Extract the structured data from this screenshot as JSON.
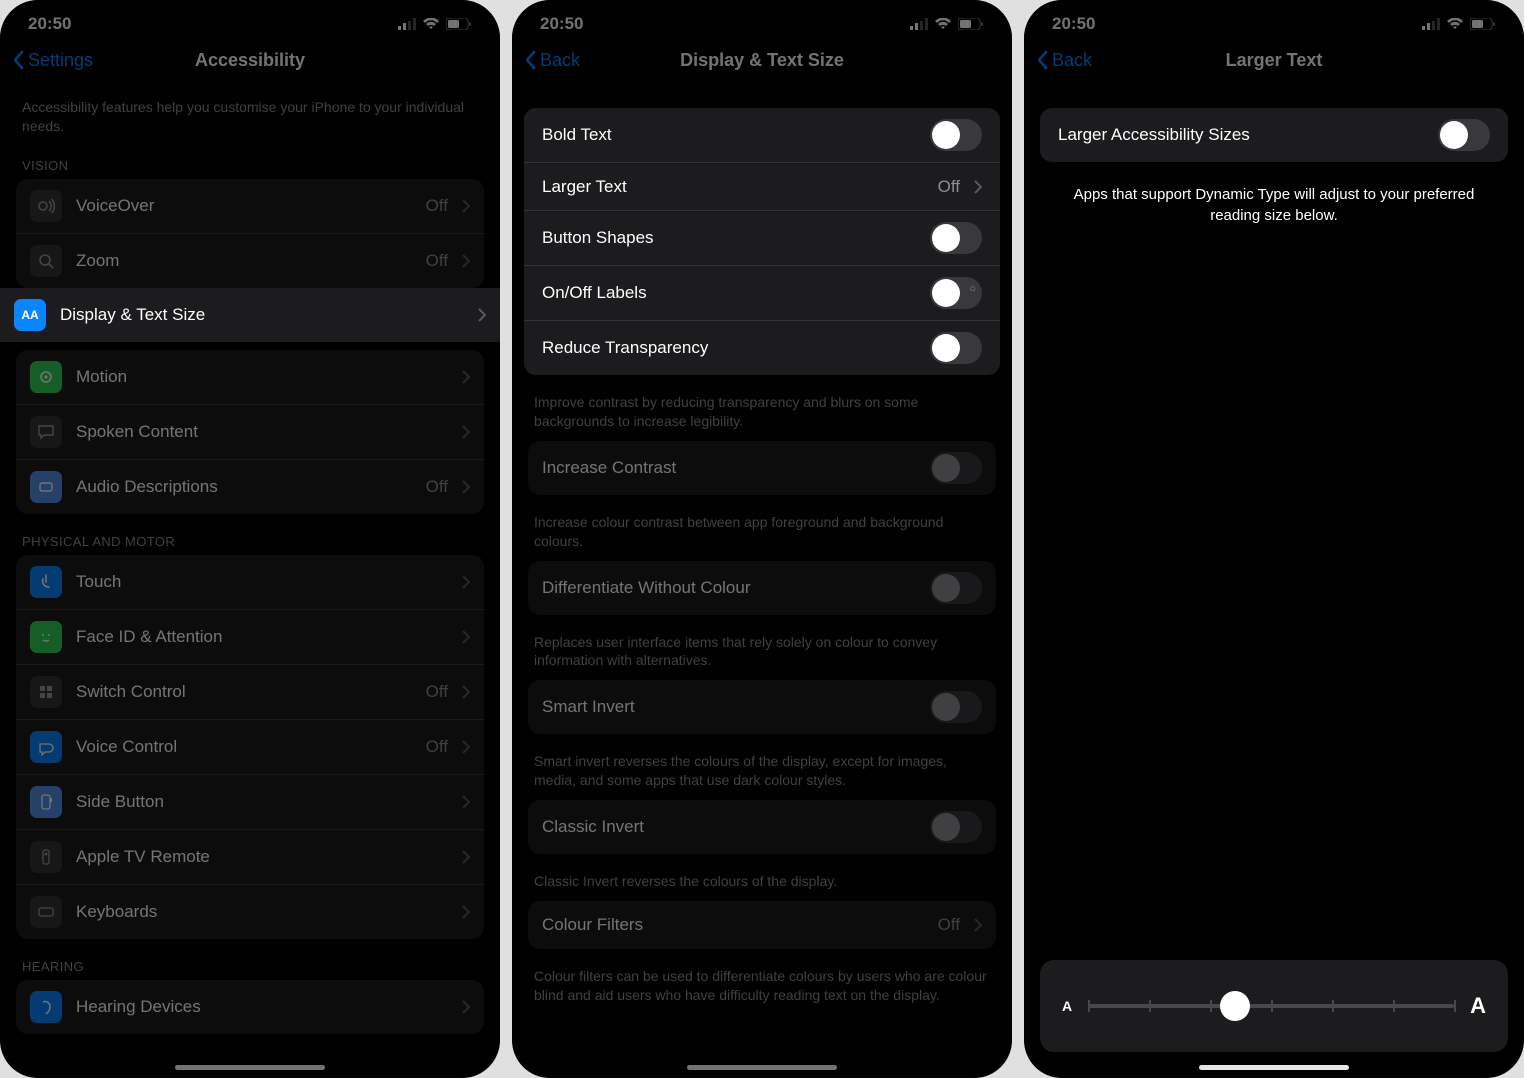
{
  "status": {
    "time": "20:50"
  },
  "phone1": {
    "back": "Settings",
    "title": "Accessibility",
    "intro": "Accessibility features help you customise your iPhone to your individual needs.",
    "sections": {
      "vision_hdr": "VISION",
      "phys_hdr": "PHYSICAL AND MOTOR",
      "hearing_hdr": "HEARING"
    },
    "items": {
      "voiceover": {
        "label": "VoiceOver",
        "value": "Off"
      },
      "zoom": {
        "label": "Zoom",
        "value": "Off"
      },
      "display": {
        "label": "Display & Text Size"
      },
      "motion": {
        "label": "Motion"
      },
      "spoken": {
        "label": "Spoken Content"
      },
      "audiodesc": {
        "label": "Audio Descriptions",
        "value": "Off"
      },
      "touch": {
        "label": "Touch"
      },
      "faceid": {
        "label": "Face ID & Attention"
      },
      "switch": {
        "label": "Switch Control",
        "value": "Off"
      },
      "voicectrl": {
        "label": "Voice Control",
        "value": "Off"
      },
      "sidebtn": {
        "label": "Side Button"
      },
      "appletv": {
        "label": "Apple TV Remote"
      },
      "keyboards": {
        "label": "Keyboards"
      },
      "hearingdev": {
        "label": "Hearing Devices"
      }
    }
  },
  "phone2": {
    "back": "Back",
    "title": "Display & Text Size",
    "items": {
      "bold": {
        "label": "Bold Text"
      },
      "larger": {
        "label": "Larger Text",
        "value": "Off"
      },
      "buttonshapes": {
        "label": "Button Shapes"
      },
      "onoff": {
        "label": "On/Off Labels"
      },
      "reducetrans": {
        "label": "Reduce Transparency"
      },
      "reducetrans_desc": "Improve contrast by reducing transparency and blurs on some backgrounds to increase legibility.",
      "incrcontrast": {
        "label": "Increase Contrast"
      },
      "incrcontrast_desc": "Increase colour contrast between app foreground and background colours.",
      "diffcolour": {
        "label": "Differentiate Without Colour"
      },
      "diffcolour_desc": "Replaces user interface items that rely solely on colour to convey information with alternatives.",
      "smartinv": {
        "label": "Smart Invert"
      },
      "smartinv_desc": "Smart invert reverses the colours of the display, except for images, media, and some apps that use dark colour styles.",
      "classicinv": {
        "label": "Classic Invert"
      },
      "classicinv_desc": "Classic Invert reverses the colours of the display.",
      "colourfilters": {
        "label": "Colour Filters",
        "value": "Off"
      },
      "colourfilters_desc": "Colour filters can be used to differentiate colours by users who are colour blind and aid users who have difficulty reading text on the display."
    }
  },
  "phone3": {
    "back": "Back",
    "title": "Larger Text",
    "toggle_label": "Larger Accessibility Sizes",
    "explain": "Apps that support Dynamic Type will adjust to your preferred reading size below.",
    "slider": {
      "small": "A",
      "big": "A"
    }
  }
}
